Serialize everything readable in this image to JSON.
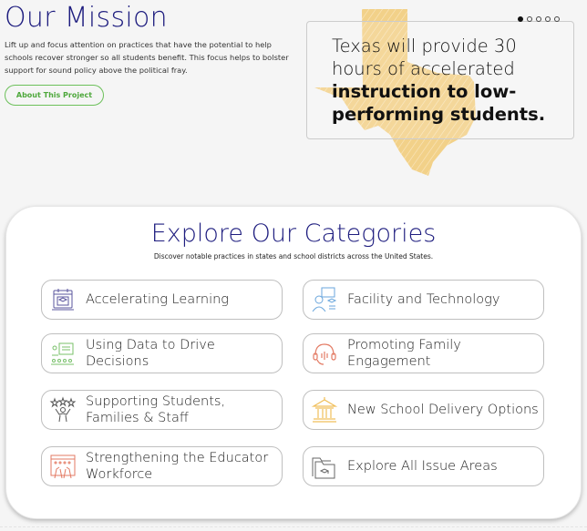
{
  "mission": {
    "title": "Our Mission",
    "text": "Lift up and focus attention on practices that have the potential to help schools recover stronger so all students benefit. This focus helps to bolster support for sound policy above the political fray.",
    "button_label": "About This Project"
  },
  "quote": {
    "text_normal": "Texas will provide 30 hours of accelerated ",
    "text_bold": "instruction to low-performing students.",
    "carousel": {
      "total": 5,
      "active_index": 0
    },
    "background_icon": "texas-map-icon",
    "accent_color": "#f2cf83"
  },
  "categories": {
    "title": "Explore Our Categories",
    "subtitle": "Discover notable practices in states and school districts across the United States.",
    "items": [
      {
        "label": "Accelerating Learning",
        "icon": "calendar-graduation-icon",
        "color": "#5a559e"
      },
      {
        "label": "Facility and Technology",
        "icon": "teacher-screen-icon",
        "color": "#6aa6dc"
      },
      {
        "label": "Using Data to Drive Decisions",
        "icon": "data-classroom-icon",
        "color": "#78c06a"
      },
      {
        "label": "Promoting Family Engagement",
        "icon": "headset-icon",
        "color": "#e37a63"
      },
      {
        "label": "Supporting Students, Families & Staff",
        "icon": "stars-person-icon",
        "color": "#555555"
      },
      {
        "label": "New School Delivery Options",
        "icon": "school-building-icon",
        "color": "#f0bf5a"
      },
      {
        "label": "Strengthening the Educator Workforce",
        "icon": "raised-hands-icon",
        "color": "#e37a63"
      },
      {
        "label": "Explore All Issue Areas",
        "icon": "folders-icon",
        "color": "#666666"
      }
    ]
  }
}
